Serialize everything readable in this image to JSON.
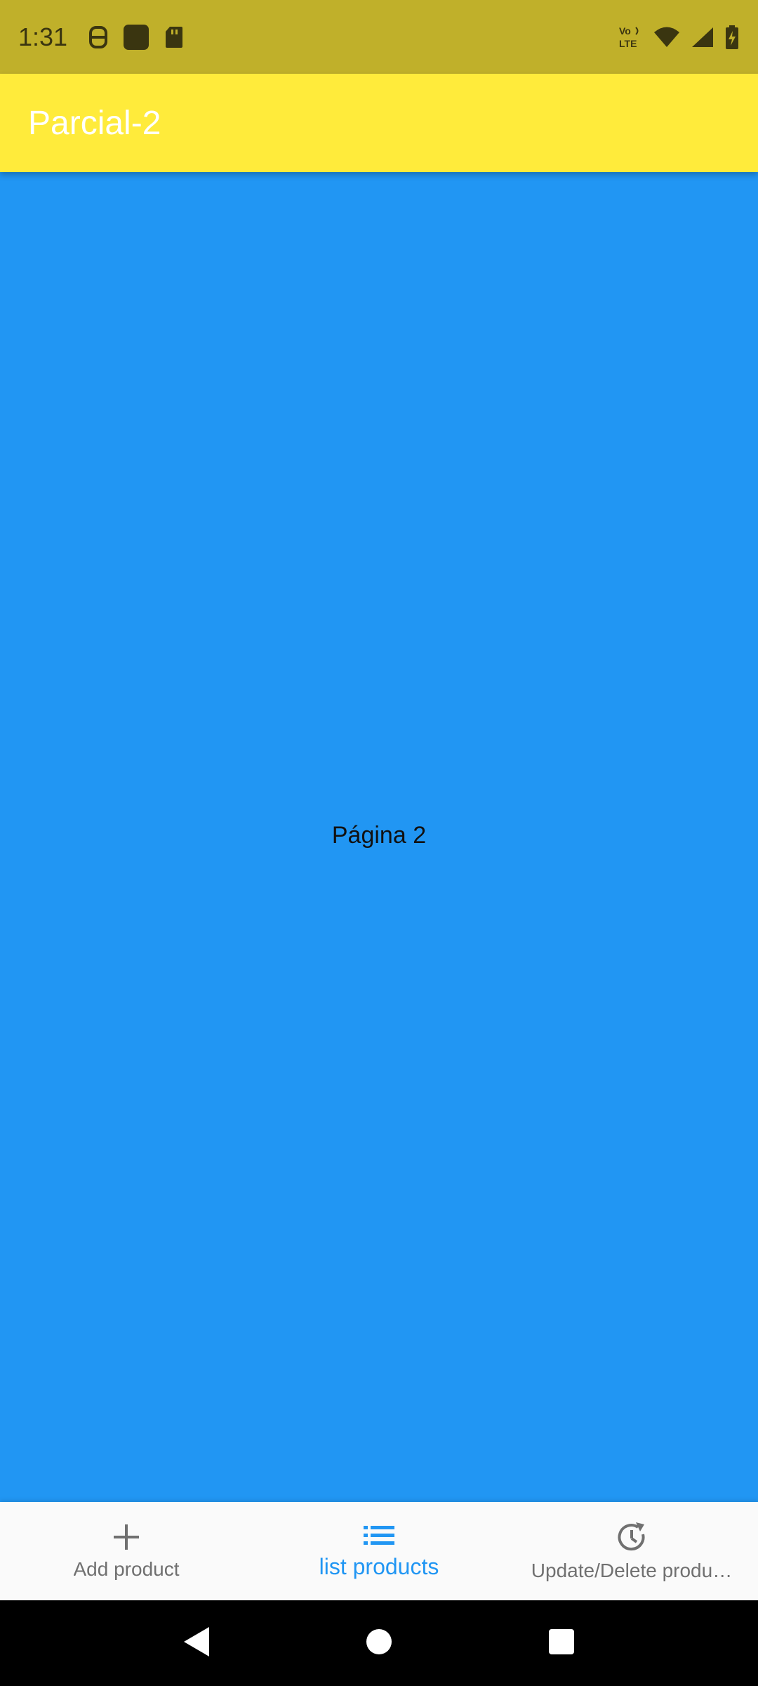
{
  "status_bar": {
    "time": "1:31",
    "icons_left": [
      "carrier-app-icon",
      "app-square-icon",
      "sd-card-icon"
    ],
    "icons_right": [
      "volte-icon",
      "wifi-icon",
      "signal-icon",
      "battery-charging-icon"
    ],
    "volte_text": "Vo LTE",
    "background": "#C0B02A"
  },
  "app_bar": {
    "title": "Parcial-2",
    "background": "#FFEB3B"
  },
  "content": {
    "text": "Página 2",
    "background": "#2196F3"
  },
  "bottom_nav": {
    "items": [
      {
        "label": "Add product",
        "icon": "add-icon",
        "active": false
      },
      {
        "label": "list products",
        "icon": "list-icon",
        "active": true
      },
      {
        "label": "Update/Delete produ…",
        "icon": "update-icon",
        "active": false
      }
    ],
    "active_color": "#2196F3",
    "inactive_color": "#707070"
  },
  "system_nav": {
    "buttons": [
      "back-icon",
      "home-icon",
      "recents-icon"
    ]
  }
}
